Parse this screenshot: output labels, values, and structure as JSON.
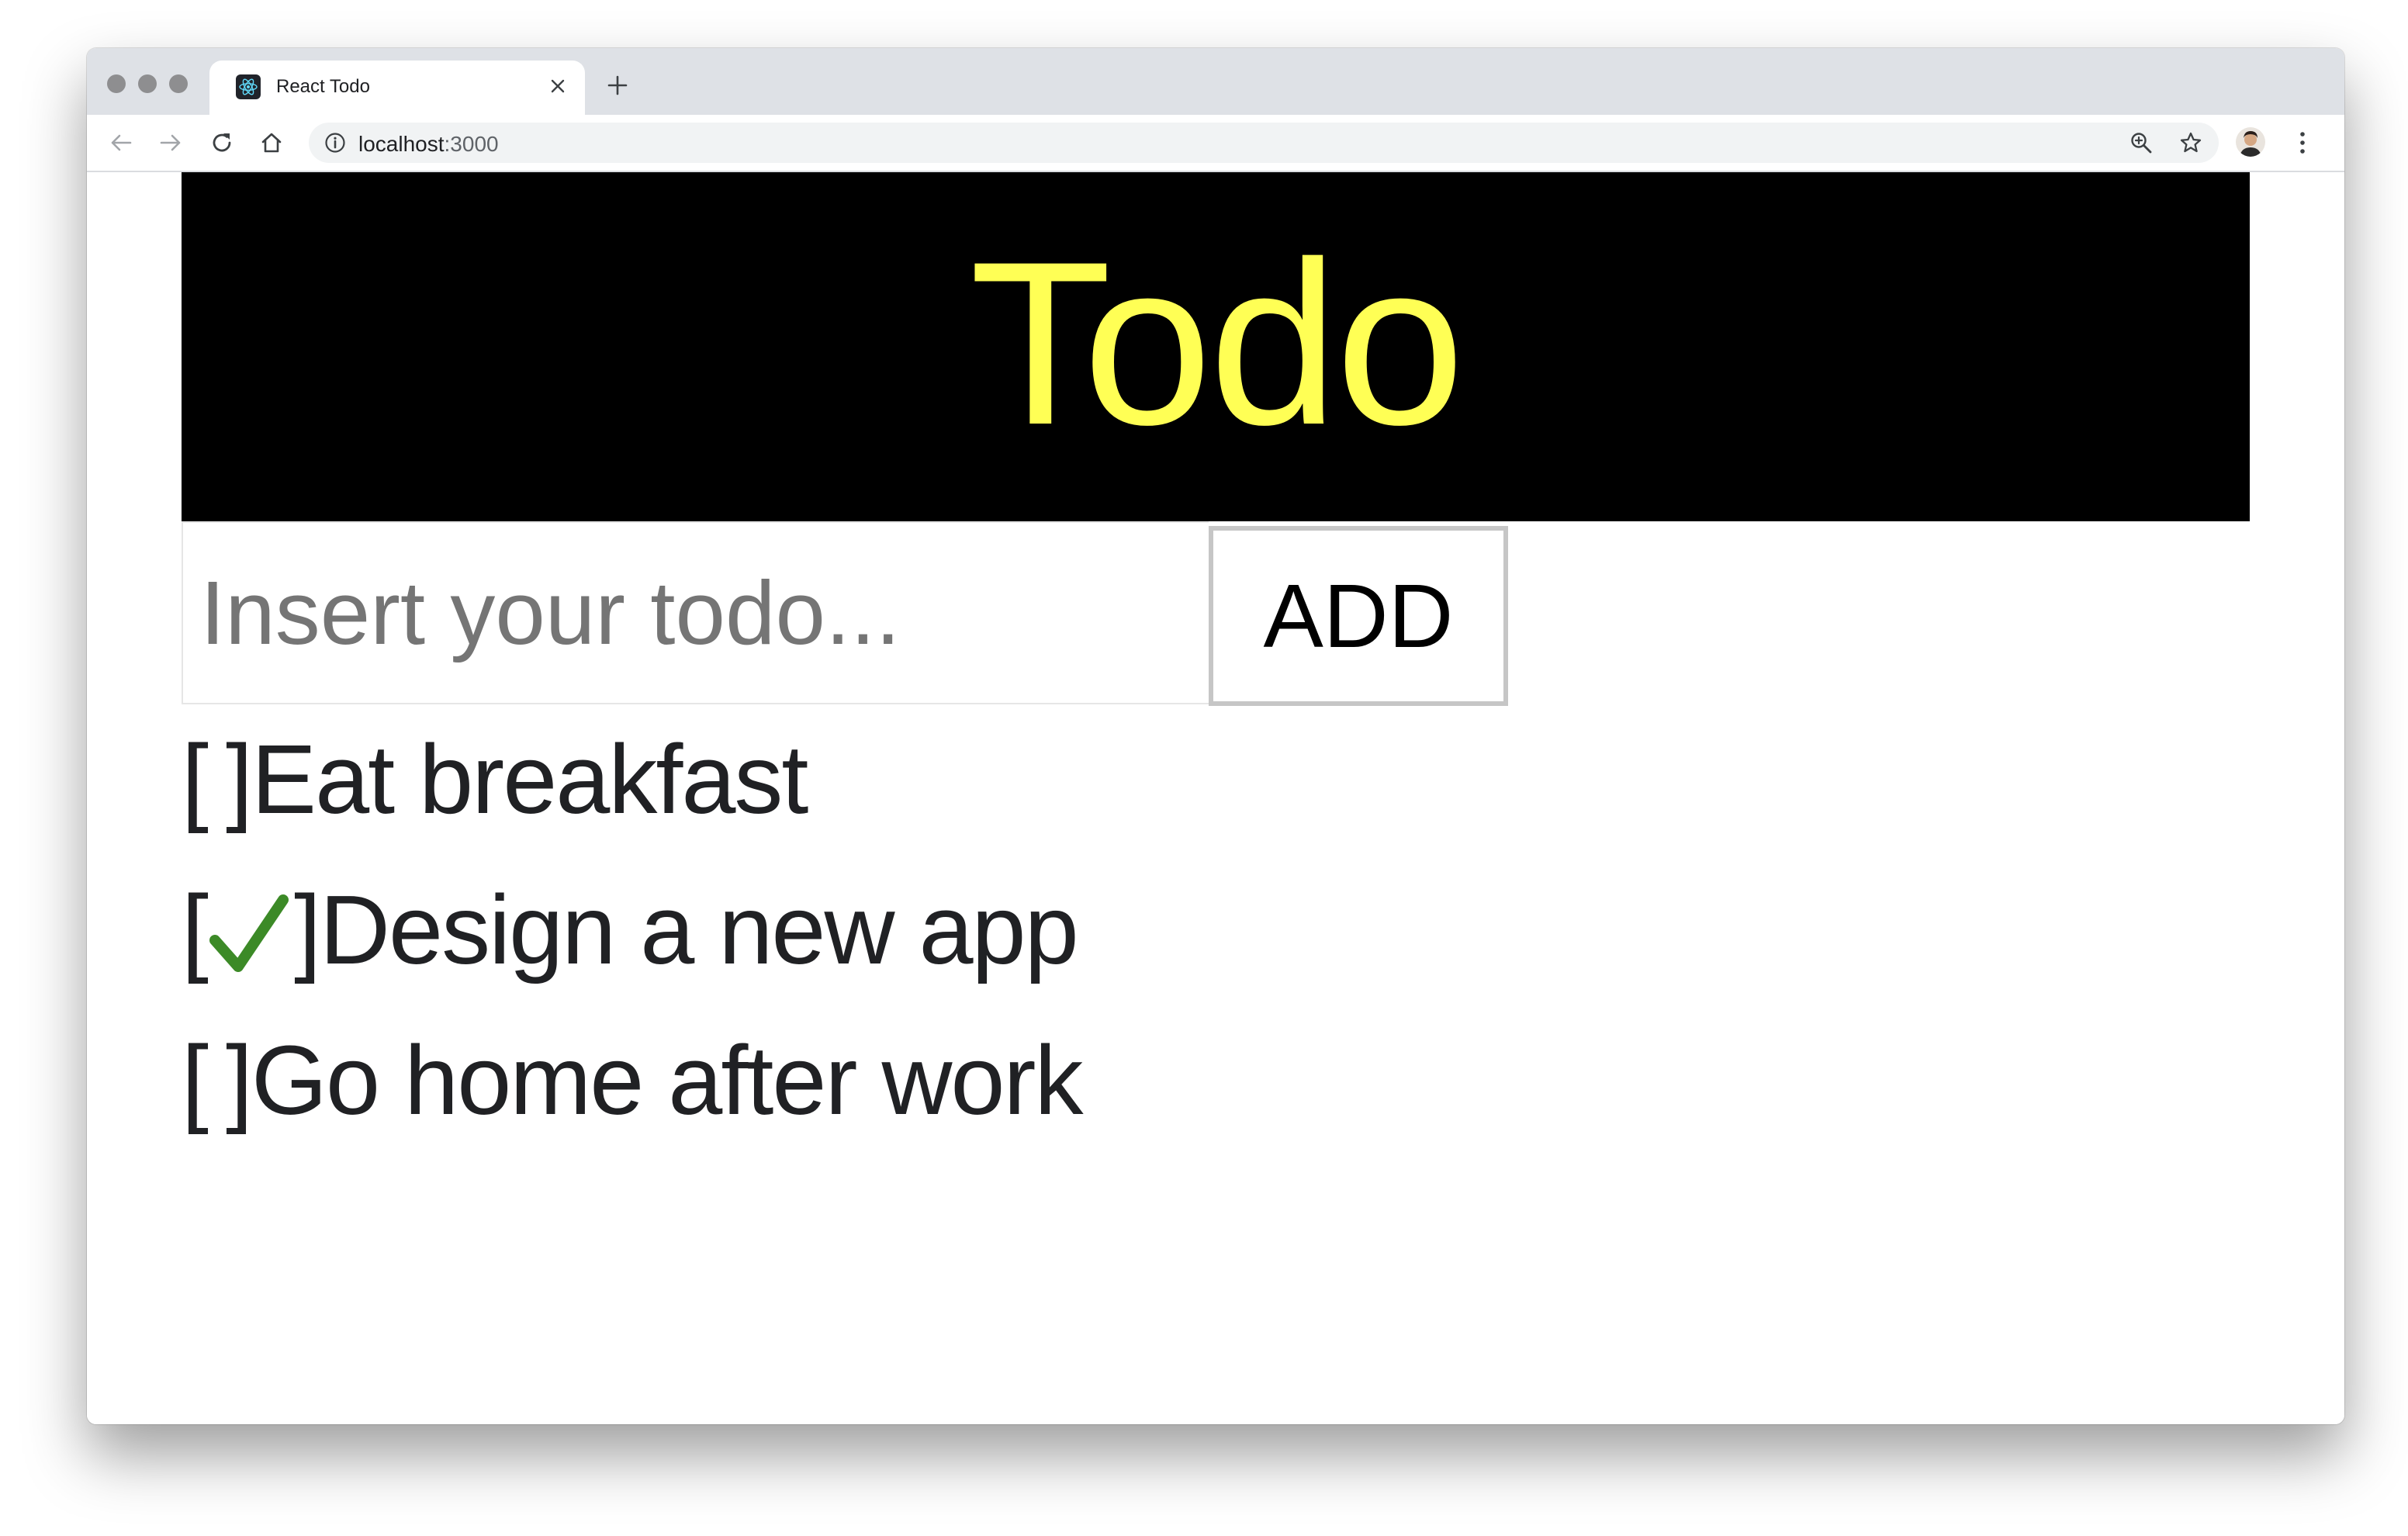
{
  "browser": {
    "tab_title": "React Todo",
    "url_host": "localhost",
    "url_port": ":3000"
  },
  "app": {
    "title": "Todo",
    "input_placeholder": "Insert your todo...",
    "add_label": "ADD",
    "todos": [
      {
        "text": "Eat breakfast",
        "done": false
      },
      {
        "text": "Design a new app",
        "done": true
      },
      {
        "text": "Go home after work",
        "done": false
      }
    ]
  },
  "colors": {
    "title": "#ffff55",
    "banner": "#000000",
    "check": "#3c8a27"
  },
  "icons": {
    "checkmark": "check-icon"
  }
}
